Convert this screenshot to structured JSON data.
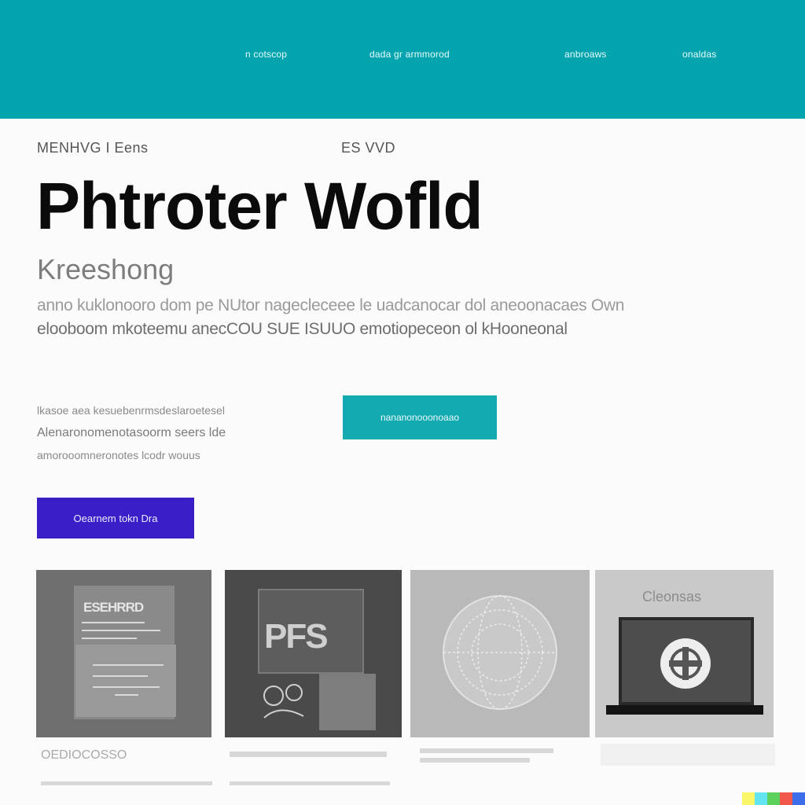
{
  "nav": {
    "items": [
      "n cotscop",
      "dada gr armmorod",
      "anbroaws",
      "onaldas"
    ]
  },
  "hero": {
    "eyebrow_left": "MENHVG  I  Eens",
    "eyebrow_right": "ES VVD",
    "title": "Phtroter Wofld",
    "subtitle": "Kreeshong",
    "body_lines": [
      "anno kuklonooro dom pe NUtor nagecleceee le uadcanocar dol aneoonacaes Own",
      "elooboom mkoteemu anecCOU SUE ISUUO emotiopeceon ol kHooneonal"
    ]
  },
  "secondary": {
    "lines": [
      "lkasoe aea kesuebenrmsdeslaroetesel",
      "Alenaronomenotasoorm seers lde",
      "amorooomneronotes lcodr wouus"
    ],
    "cta_teal": "nananonooonoaao",
    "cta_purple": "Oearnem tokn Dra"
  },
  "cards": {
    "card1_heading": "ESEHRRD",
    "card2_heading": "PFS",
    "card4_heading": "Cleonsas",
    "captions": [
      "OEDIOCOSSO"
    ]
  },
  "colors": {
    "header_bg": "#03a4ae",
    "teal_button": "#14aab2",
    "purple_button": "#3a1fc8",
    "title_text": "#0b0b0b"
  },
  "icons": {
    "card3": "globe-icon",
    "card4": "laptop-icon"
  }
}
